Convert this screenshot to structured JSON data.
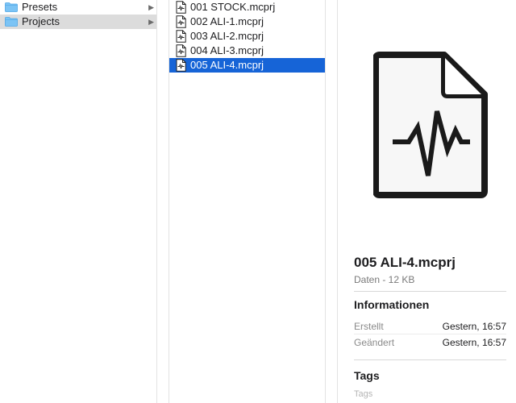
{
  "sidebar_column": {
    "items": [
      {
        "label": "Presets",
        "icon": "folder-icon",
        "state": "normal"
      },
      {
        "label": "Projects",
        "icon": "folder-icon",
        "state": "open"
      }
    ]
  },
  "file_column": {
    "files": [
      {
        "label": "001 STOCK.mcprj",
        "icon": "document-waveform-icon"
      },
      {
        "label": "002 ALI-1.mcprj",
        "icon": "document-waveform-icon"
      },
      {
        "label": "003 ALI-2.mcprj",
        "icon": "document-waveform-icon"
      },
      {
        "label": "004 ALI-3.mcprj",
        "icon": "document-waveform-icon"
      },
      {
        "label": "005 ALI-4.mcprj",
        "icon": "document-waveform-icon",
        "selected": true
      }
    ]
  },
  "preview": {
    "icon": "document-waveform-icon",
    "file_name": "005 ALI-4.mcprj",
    "subtitle": "Daten - 12 KB",
    "info_heading": "Informationen",
    "info": [
      {
        "key": "Erstellt",
        "value": "Gestern, 16:57"
      },
      {
        "key": "Geändert",
        "value": "Gestern, 16:57"
      }
    ],
    "tags_heading": "Tags",
    "tags_placeholder": "Tags"
  },
  "colors": {
    "selection": "#1664d7",
    "open_folder_row": "#dcdcdc",
    "folder": "#5fb4f0"
  }
}
